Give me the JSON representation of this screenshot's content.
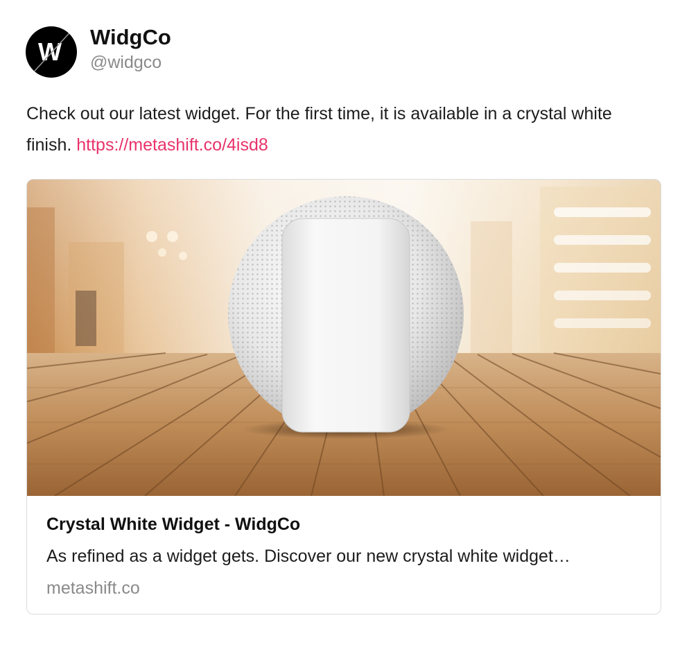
{
  "account": {
    "avatar_letter": "W",
    "display_name": "WidgCo",
    "handle": "@widgco"
  },
  "post": {
    "text": "Check out our latest widget. For the first time, it is available in a crystal white finish.",
    "link_text": "https://metashift.co/4isd8"
  },
  "link_card": {
    "title": "Crystal White Widget - WidgCo",
    "description": "As refined as a widget gets. Discover our new crystal white widget…",
    "domain": "metashift.co"
  },
  "colors": {
    "link": "#e8336b",
    "secondary_text": "#8a8a8a"
  }
}
